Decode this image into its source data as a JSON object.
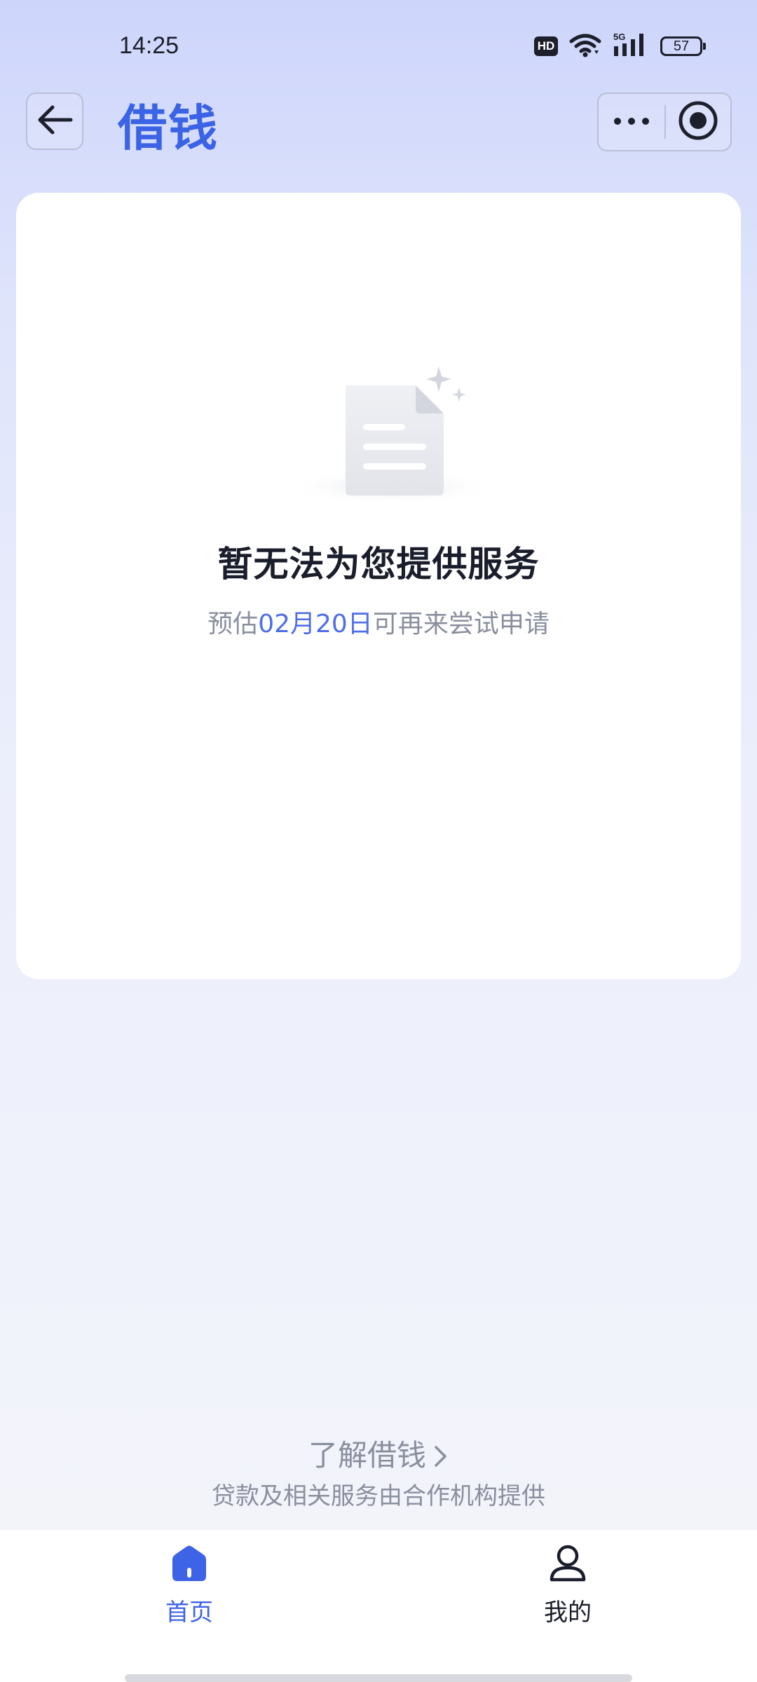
{
  "status_bar": {
    "time": "14:25",
    "hd": "HD",
    "network": "5G",
    "battery": "57",
    "icons": [
      "hd-icon",
      "wifi-icon",
      "signal-5g-icon",
      "battery-icon"
    ]
  },
  "header": {
    "title": "借钱",
    "back_icon": "arrow-left-icon",
    "more_icon": "more-dots-icon",
    "close_icon": "target-close-icon"
  },
  "notice": {
    "illustration": "empty-document-icon",
    "title": "暂无法为您提供服务",
    "sub_prefix": "预估",
    "sub_date": "02月20日",
    "sub_suffix": "可再来尝试申请"
  },
  "footer": {
    "learn_more": "了解借钱",
    "learn_more_icon": "chevron-right-icon",
    "disclaimer": "贷款及相关服务由合作机构提供"
  },
  "tabs": [
    {
      "label": "首页",
      "icon": "home-icon",
      "active": true
    },
    {
      "label": "我的",
      "icon": "user-icon",
      "active": false
    }
  ],
  "colors": {
    "accent": "#3a63e6",
    "date_highlight": "#4d6ee8",
    "muted_text": "#8a8f9e"
  }
}
